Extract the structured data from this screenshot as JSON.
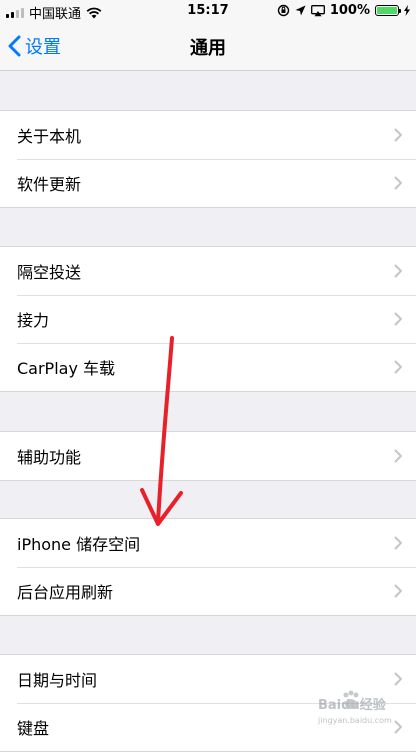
{
  "status_bar": {
    "carrier": "中国联通",
    "time": "15:17",
    "battery_percent": "100%",
    "battery_level": 1.0
  },
  "nav": {
    "back_label": "设置",
    "title": "通用"
  },
  "groups": [
    {
      "items": [
        "关于本机",
        "软件更新"
      ]
    },
    {
      "items": [
        "隔空投送",
        "接力",
        "CarPlay 车载"
      ]
    },
    {
      "items": [
        "辅助功能"
      ]
    },
    {
      "items": [
        "iPhone 储存空间",
        "后台应用刷新"
      ]
    },
    {
      "items": [
        "日期与时间",
        "键盘"
      ]
    }
  ],
  "watermark": {
    "text": "Baidu经验",
    "sub": "jingyan.baidu.com"
  },
  "colors": {
    "accent": "#007aff",
    "annotation_arrow": "#e8202a",
    "battery": "#4cd964"
  }
}
